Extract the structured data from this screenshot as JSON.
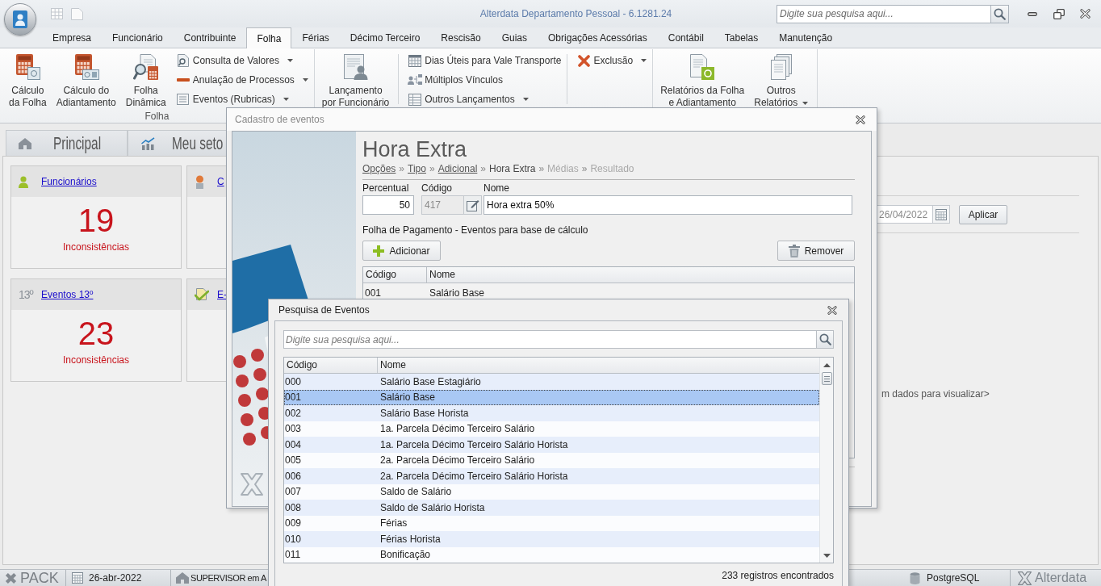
{
  "window": {
    "title": "Alterdata Departamento Pessoal - 6.1281.24",
    "search": {
      "placeholder": "Digite sua pesquisa aqui..."
    }
  },
  "ribbon_tabs": [
    {
      "label": "Empresa",
      "selected": false
    },
    {
      "label": "Funcionário",
      "selected": false
    },
    {
      "label": "Contribuinte",
      "selected": false
    },
    {
      "label": "Folha",
      "selected": true
    },
    {
      "label": "Férias",
      "selected": false
    },
    {
      "label": "Décimo Terceiro",
      "selected": false
    },
    {
      "label": "Rescisão",
      "selected": false
    },
    {
      "label": "Guias",
      "selected": false
    },
    {
      "label": "Obrigações Acessórias",
      "selected": false
    },
    {
      "label": "Contábil",
      "selected": false
    },
    {
      "label": "Tabelas",
      "selected": false
    },
    {
      "label": "Manutenção",
      "selected": false
    }
  ],
  "ribbon": {
    "groups": [
      {
        "label": "Folha",
        "items": [
          {
            "kind": "large",
            "lines": [
              "Cálculo",
              "da Folha"
            ],
            "dropdown": false
          },
          {
            "kind": "large",
            "lines": [
              "Cálculo do",
              "Adiantamento"
            ],
            "dropdown": false
          },
          {
            "kind": "large",
            "lines": [
              "Folha",
              "Dinâmica"
            ],
            "dropdown": false
          },
          {
            "kind": "stack",
            "entries": [
              {
                "label": "Consulta de Valores",
                "dropdown": true
              },
              {
                "label": "Anulação de Processos",
                "dropdown": true
              },
              {
                "label": "Eventos (Rubricas)",
                "dropdown": true
              }
            ]
          }
        ]
      },
      {
        "items": [
          {
            "kind": "large",
            "lines": [
              "Lançamento",
              "por Funcionário"
            ],
            "dropdown": false
          },
          {
            "kind": "separator"
          },
          {
            "kind": "stack",
            "entries": [
              {
                "label": "Dias Úteis para Vale Transporte",
                "dropdown": false
              },
              {
                "label": "Múltiplos Vínculos",
                "dropdown": false
              },
              {
                "label": "Outros Lançamentos",
                "dropdown": true
              }
            ]
          },
          {
            "kind": "separator"
          },
          {
            "kind": "stack",
            "entries": [
              {
                "label": "Exclusão",
                "dropdown": true
              }
            ]
          }
        ]
      },
      {
        "items": [
          {
            "kind": "large",
            "lines": [
              "Relatórios da Folha",
              "e Adiantamento"
            ],
            "dropdown": false
          },
          {
            "kind": "large",
            "lines": [
              "Outros",
              "Relatórios"
            ],
            "dropdown": true
          }
        ]
      }
    ]
  },
  "main_tabs": [
    {
      "label": "Principal"
    },
    {
      "label": "Meu seto"
    }
  ],
  "cards": [
    {
      "title": "Funcionários",
      "value": "19",
      "caption": "Inconsistências"
    },
    {
      "title": "C"
    },
    {
      "title": "Eventos 13º",
      "icon_text": "13º",
      "value": "23",
      "caption": "Inconsistências"
    },
    {
      "title": "E-"
    }
  ],
  "filter": {
    "date": "26/04/2022",
    "apply_button": "Aplicar"
  },
  "chart_area": {
    "message": "m dados para visualizar>"
  },
  "event_dialog": {
    "title": "Cadastro de eventos",
    "heading": "Hora Extra",
    "breadcrumb": [
      {
        "label": "Opções",
        "kind": "link"
      },
      {
        "prefix": "»",
        "label": "Tipo",
        "kind": "link"
      },
      {
        "prefix": "»",
        "label": "Adicional",
        "kind": "link"
      },
      {
        "prefix": "»",
        "label": "Hora Extra",
        "kind": "current"
      },
      {
        "prefix": "»",
        "label": "Médias",
        "kind": "pending"
      },
      {
        "prefix": "»",
        "label": "Resultado",
        "kind": "pending"
      }
    ],
    "fields": [
      {
        "kind": "number",
        "label": "Percentual",
        "value": "50",
        "disabled": false
      },
      {
        "kind": "code",
        "label": "Código",
        "value": "417",
        "disabled": true
      },
      {
        "kind": "text",
        "label": "Nome",
        "value": "Hora extra 50%",
        "disabled": false
      }
    ],
    "section_title": "Folha de Pagamento - Eventos para base de cálculo",
    "add_button": "Adicionar",
    "remove_button": "Remover",
    "table": {
      "columns": [
        "Código",
        "Nome"
      ],
      "rows": [
        {
          "code": "001",
          "name": "Salário Base"
        }
      ]
    }
  },
  "search_dialog": {
    "title": "Pesquisa de Eventos",
    "search": {
      "placeholder": "Digite sua pesquisa aqui..."
    },
    "table": {
      "columns": [
        "Código",
        "Nome"
      ],
      "rows": [
        {
          "code": "000",
          "name": "Salário Base Estagiário",
          "selected": false
        },
        {
          "code": "001",
          "name": "Salário Base",
          "selected": true
        },
        {
          "code": "002",
          "name": "Salário Base Horista",
          "selected": false
        },
        {
          "code": "003",
          "name": "1a. Parcela Décimo Terceiro Salário",
          "selected": false
        },
        {
          "code": "004",
          "name": "1a. Parcela Décimo Terceiro Salário Horista",
          "selected": false
        },
        {
          "code": "005",
          "name": "2a. Parcela Décimo Terceiro Salário",
          "selected": false
        },
        {
          "code": "006",
          "name": "2a. Parcela Décimo Terceiro Salário Horista",
          "selected": false
        },
        {
          "code": "007",
          "name": "Saldo de Salário",
          "selected": false
        },
        {
          "code": "008",
          "name": "Saldo de Salário Horista",
          "selected": false
        },
        {
          "code": "009",
          "name": "Férias",
          "selected": false
        },
        {
          "code": "010",
          "name": "Férias Horista",
          "selected": false
        },
        {
          "code": "011",
          "name": "Bonificação",
          "selected": false
        }
      ]
    },
    "footer": "233 registros encontrados"
  },
  "status_bar": {
    "logo": "PACK",
    "date": "26-abr-2022",
    "user": "SUPERVISOR em A",
    "database": "PostgreSQL",
    "brand": "Alterdata"
  }
}
